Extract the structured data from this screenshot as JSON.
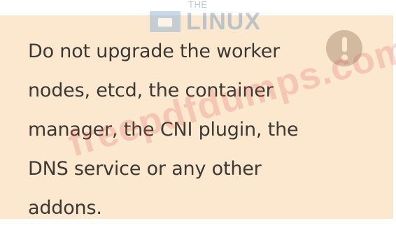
{
  "callout": {
    "lines": [
      "Do not upgrade the worker",
      "nodes, etcd, the container",
      "manager, the CNI plugin, the",
      "DNS service or any other",
      "addons."
    ],
    "icon": "warning-exclamation-icon"
  },
  "watermarks": {
    "logo_small_text": "THE",
    "logo_text": "LINUX",
    "site_text": "freepdfdumps.com"
  },
  "colors": {
    "callout_background": "#fbe8cf",
    "text": "#3c3833",
    "icon": "#d0b79e",
    "watermark_red": "#e05353",
    "logo_blue": "#7e9fc0"
  }
}
